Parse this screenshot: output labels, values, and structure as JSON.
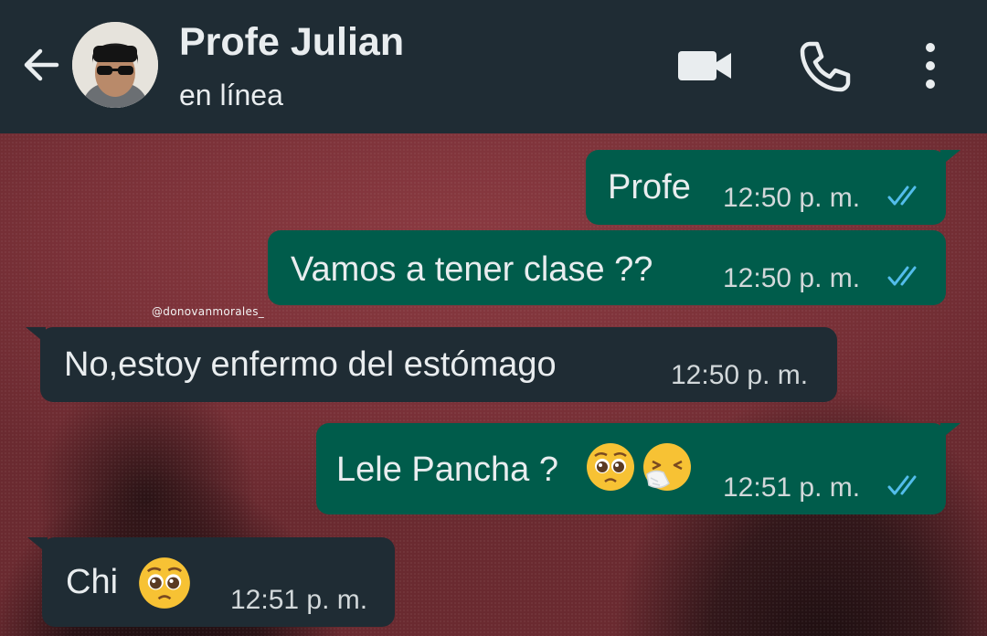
{
  "header": {
    "contact_name": "Profe Julian",
    "status": "en línea",
    "icons": [
      "back-arrow-icon",
      "video-call-icon",
      "phone-call-icon",
      "more-options-icon"
    ]
  },
  "watermark": "@donovanmorales_",
  "messages": [
    {
      "direction": "outgoing",
      "text": "Profe",
      "time": "12:50 p. m.",
      "read": true
    },
    {
      "direction": "outgoing",
      "text": "Vamos a tener clase ??",
      "time": "12:50 p. m.",
      "read": true
    },
    {
      "direction": "incoming",
      "text": "No,estoy enfermo del estómago",
      "time": "12:50 p. m."
    },
    {
      "direction": "outgoing",
      "text": "Lele Pancha ?",
      "emojis": [
        "pleading-face",
        "sneezing-face"
      ],
      "time": "12:51 p. m.",
      "read": true
    },
    {
      "direction": "incoming",
      "text": "Chi",
      "emojis": [
        "pleading-face"
      ],
      "time": "12:51 p. m."
    }
  ],
  "colors": {
    "header_bg": "#1f2c34",
    "outgoing_bubble": "#005c4b",
    "incoming_bubble": "#1f2c34",
    "read_ticks": "#53bdeb",
    "text": "#e9edef"
  }
}
